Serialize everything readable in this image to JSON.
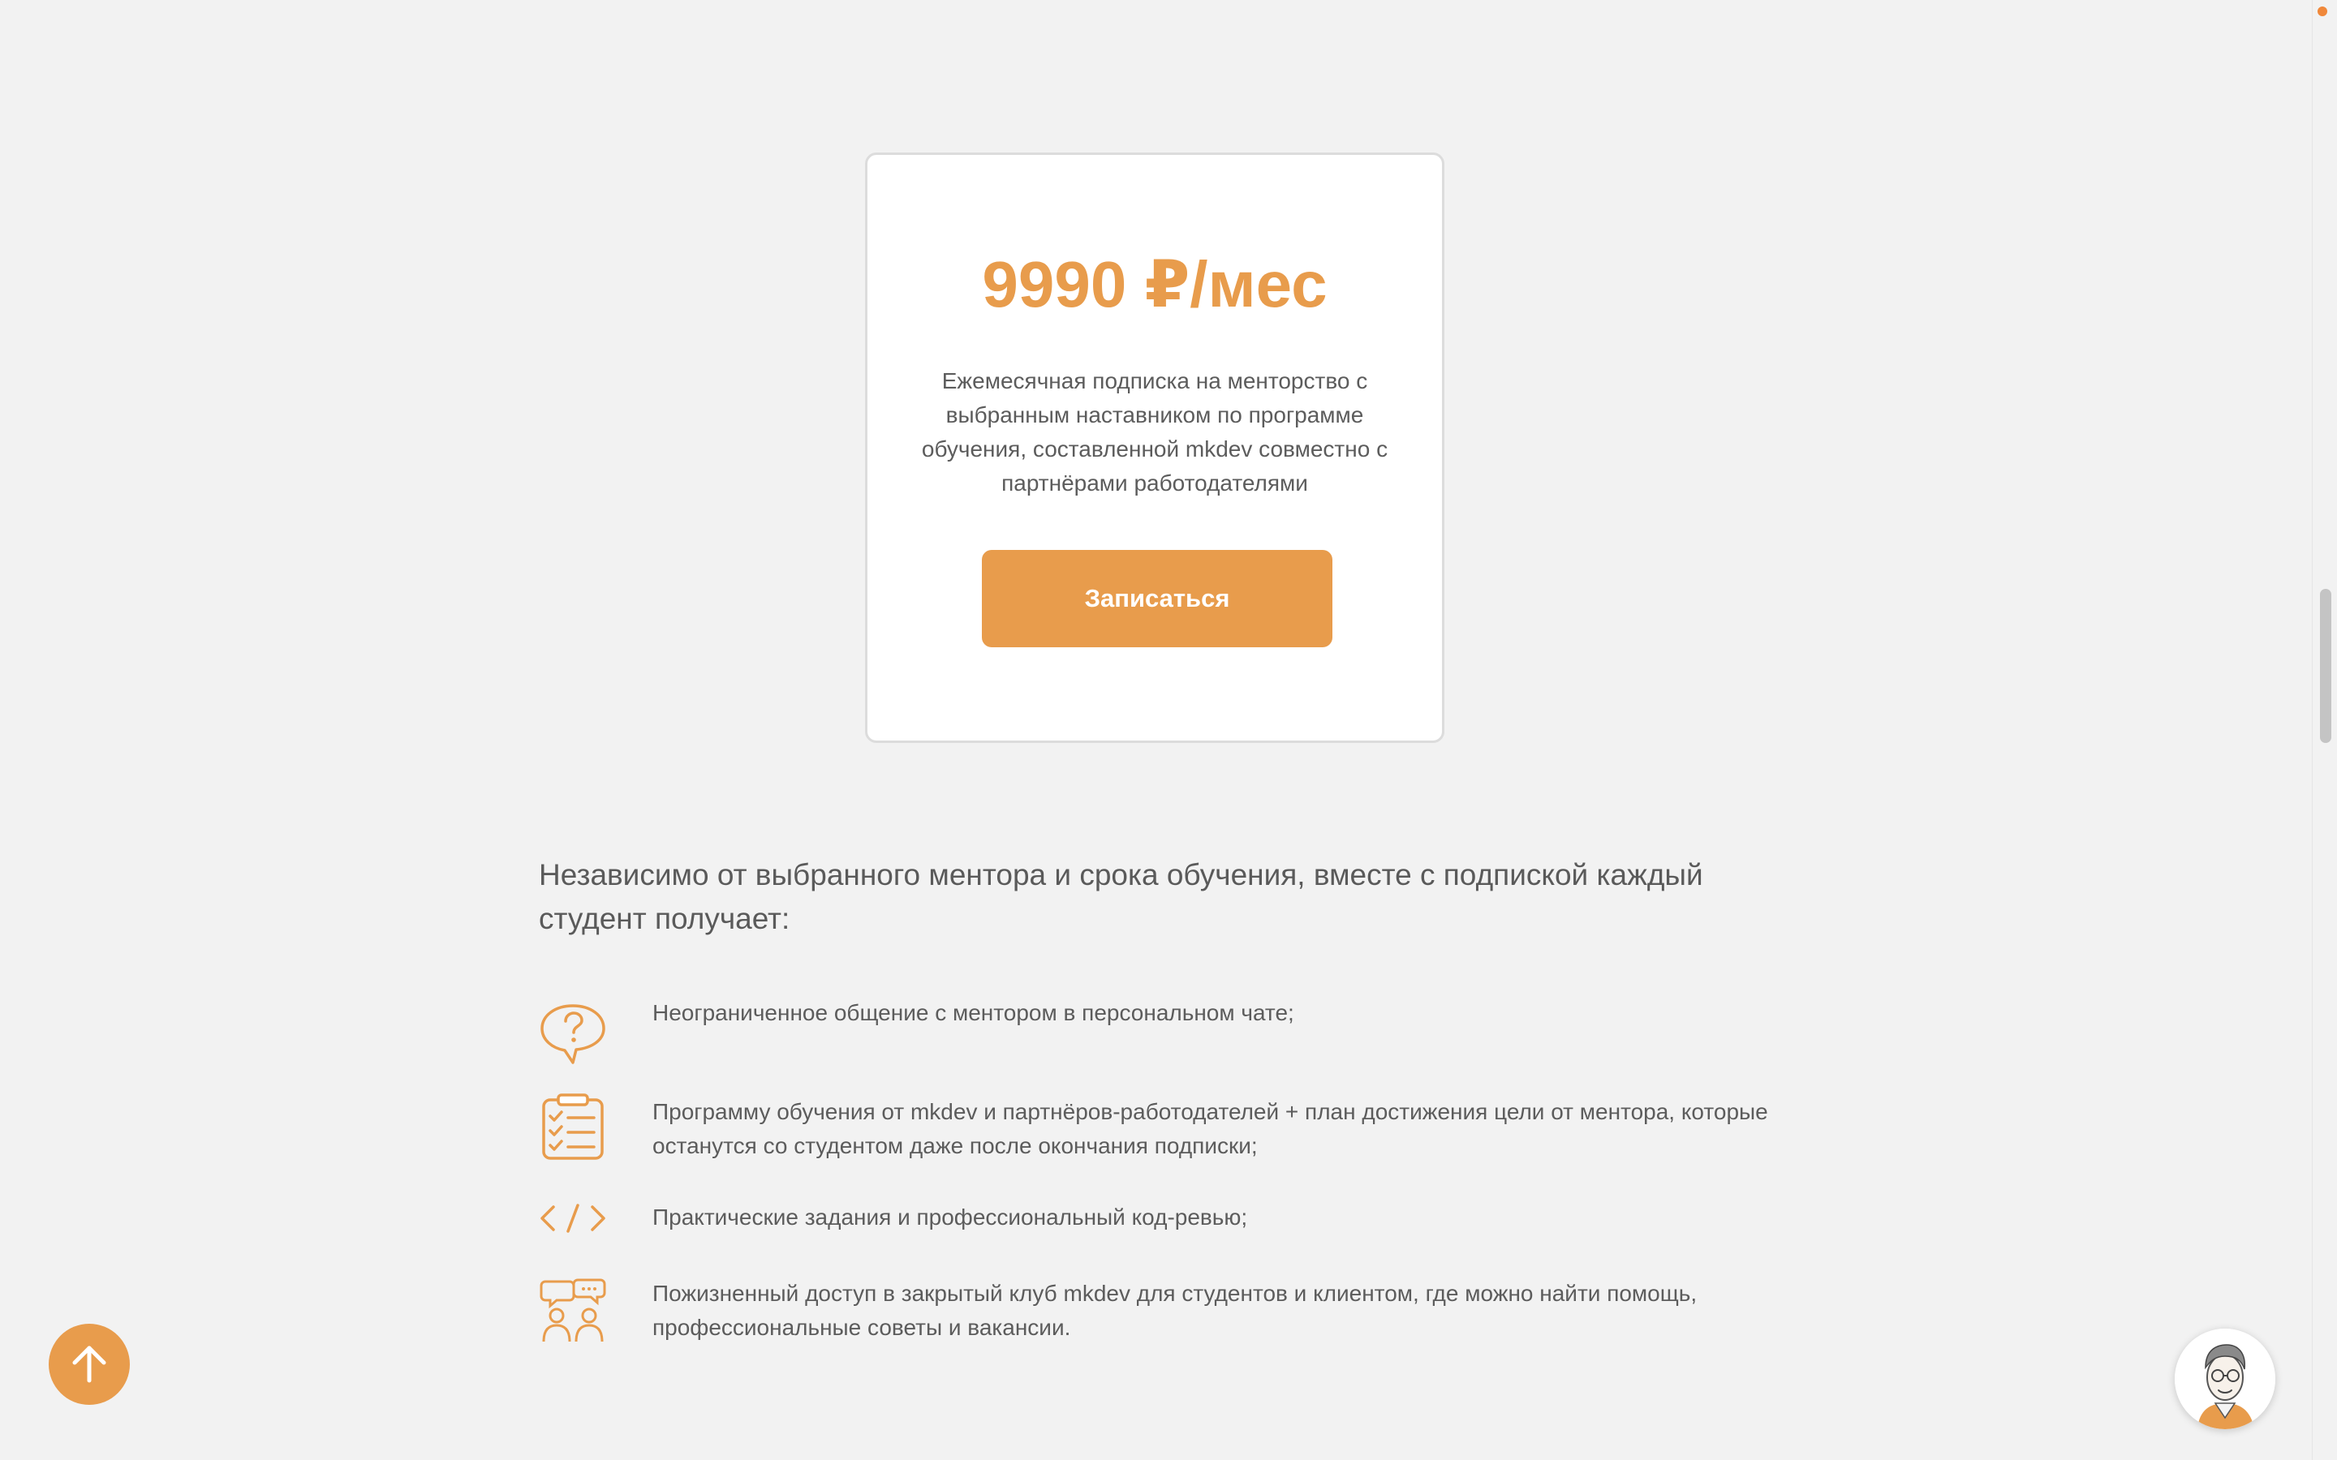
{
  "pricing": {
    "price": "9990 ₽/мес",
    "description": "Ежемесячная подписка на менторство с выбранным наставником по программе обучения, составленной mkdev совместно с партнёрами работодателями",
    "button_label": "Записаться"
  },
  "intro": "Независимо от выбранного ментора и срока обучения, вместе с подпиской каждый студент получает:",
  "benefits": [
    {
      "icon": "chat-question-icon",
      "text": "Неограниченное общение с ментором в персональном чате;"
    },
    {
      "icon": "checklist-icon",
      "text": "Программу обучения от mkdev и партнёров-работодателей + план достижения цели от ментора, которые останутся со студентом даже после окончания подписки;"
    },
    {
      "icon": "code-icon",
      "text": "Практические задания и профессиональный код-ревью;"
    },
    {
      "icon": "community-icon",
      "text": "Пожизненный доступ в закрытый клуб mkdev для студентов и клиентом, где можно найти помощь, профессиональные советы и вакансии."
    }
  ],
  "widgets": {
    "scroll_top_icon": "arrow-up-icon",
    "chat_avatar_icon": "mentor-avatar-icon"
  },
  "colors": {
    "accent": "#e89c4c",
    "background": "#f2f2f2",
    "text": "#5c5c5c"
  }
}
